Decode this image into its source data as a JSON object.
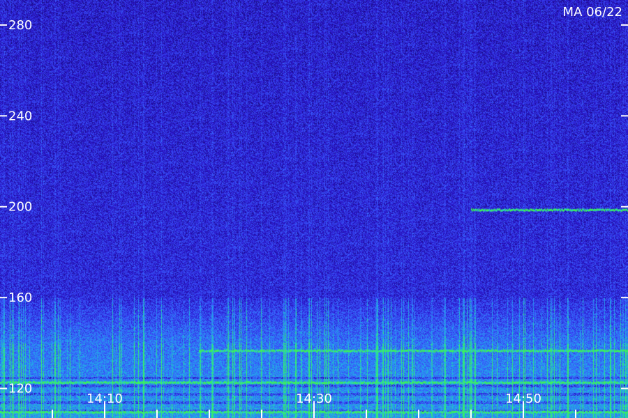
{
  "chart_data": {
    "type": "heatmap",
    "station_label": "MA 06/22",
    "y_ticks": [
      120,
      160,
      200,
      240,
      280
    ],
    "ylim": [
      107,
      291
    ],
    "x_labels": [
      {
        "t": 10,
        "label": "14:10"
      },
      {
        "t": 30,
        "label": "14:30"
      },
      {
        "t": 50,
        "label": "14:50"
      }
    ],
    "x_minor_ticks": [
      5,
      10,
      15,
      20,
      25,
      30,
      35,
      40,
      45,
      50,
      55
    ],
    "xlim": [
      0,
      60
    ],
    "colormap": [
      "#0a0540",
      "#2a12c8",
      "#3a5cff",
      "#1fb2e8",
      "#35f06a"
    ],
    "lines": [
      {
        "freq": 137,
        "t_start": 19,
        "t_end": 60
      },
      {
        "freq": 199,
        "t_start": 45,
        "t_end": 60
      },
      {
        "freq": 110,
        "t_start": 0,
        "t_end": 60
      },
      {
        "freq": 123,
        "t_start": 0,
        "t_end": 60
      }
    ]
  }
}
